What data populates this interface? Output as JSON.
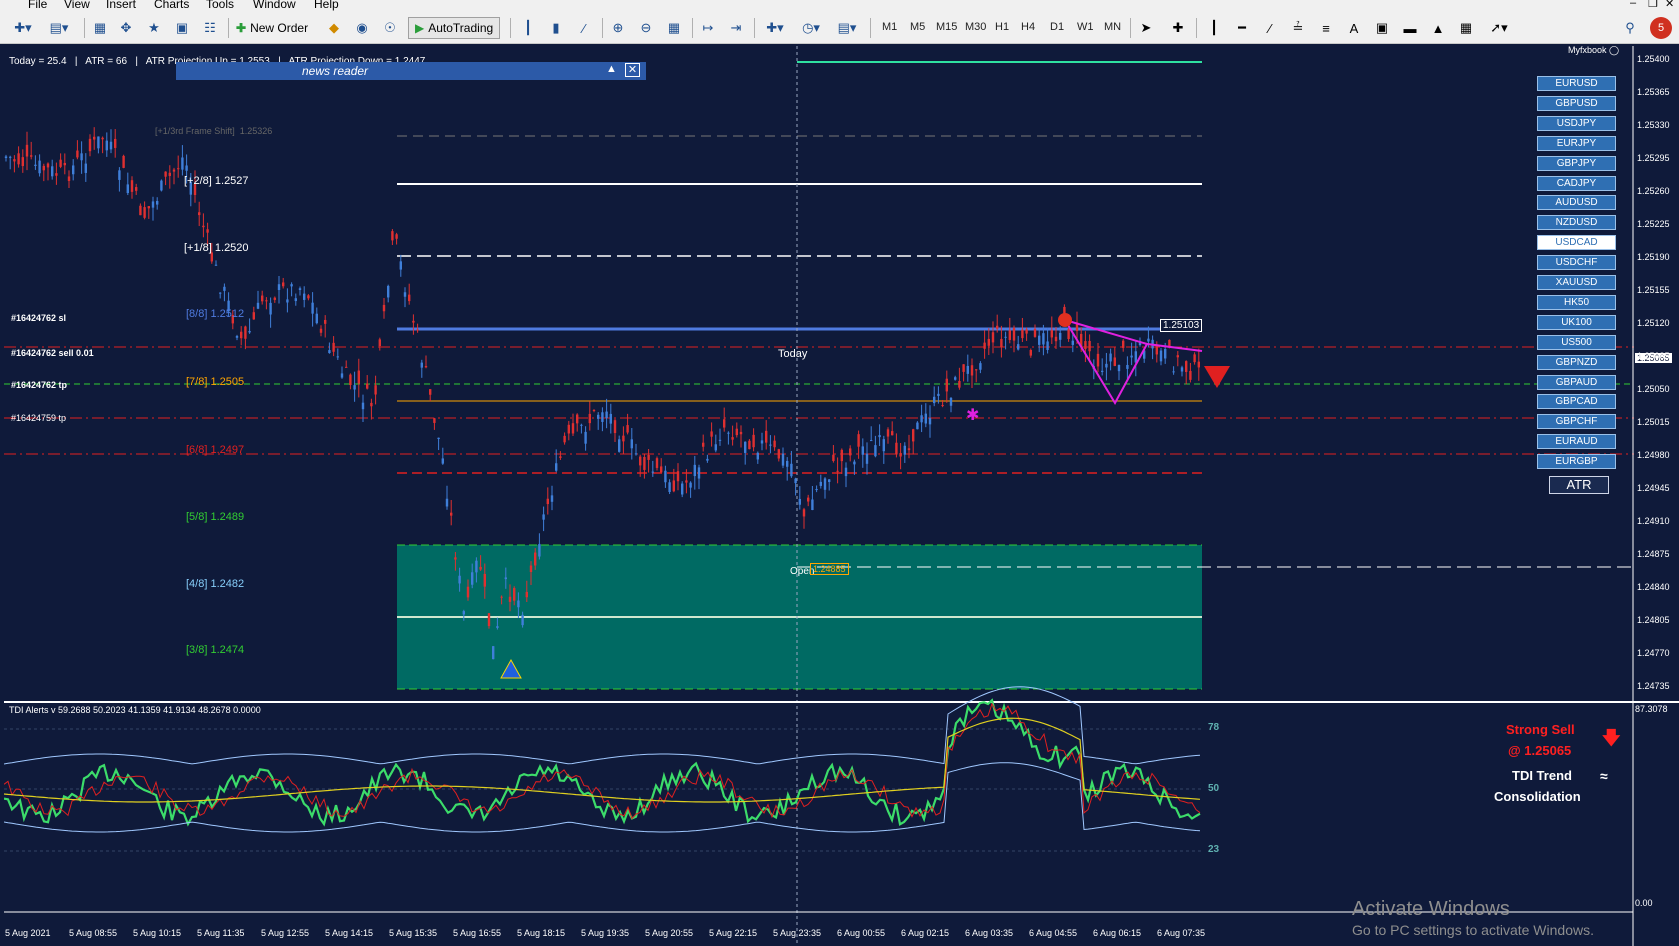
{
  "menu": {
    "items": [
      "File",
      "View",
      "Insert",
      "Charts",
      "Tools",
      "Window",
      "Help"
    ]
  },
  "toolbar": {
    "new_order_label": "New Order",
    "autotrading_label": "AutoTrading",
    "timeframes": [
      "M1",
      "M5",
      "M15",
      "M30",
      "H1",
      "H4",
      "D1",
      "W1",
      "MN"
    ]
  },
  "chart": {
    "info_line": "Today = 25.4   |   ATR = 66   |   ATR Projection Up = 1.2553   |   ATR Projection Down = 1.2447",
    "news_reader": "news reader",
    "myfxbook": "Myfxbook",
    "frame_shift": "[+1/3rd Frame Shift]  1.25326",
    "today_label": "Today",
    "open_label": "Open",
    "open_price": "1.24885",
    "current_price_label": "1.25103",
    "bid_price_label": "1.25065",
    "order_labels": [
      "#16424762 sl",
      "#16424762 sell 0.01",
      "#16424762 tp",
      "#16424759 tp"
    ],
    "murrey_levels": [
      {
        "label": "[+2/8]",
        "price": "1.2527",
        "color": "#ffffff"
      },
      {
        "label": "[+1/8]",
        "price": "1.2520",
        "color": "#ffffff"
      },
      {
        "label": "[8/8]",
        "price": "1.2512",
        "color": "#4f7be0"
      },
      {
        "label": "[7/8]",
        "price": "1.2505",
        "color": "#ffa500"
      },
      {
        "label": "[6/8]",
        "price": "1.2497",
        "color": "#e02020"
      },
      {
        "label": "[5/8]",
        "price": "1.2489",
        "color": "#32cd32"
      },
      {
        "label": "[4/8]",
        "price": "1.2482",
        "color": "#87cefa"
      },
      {
        "label": "[3/8]",
        "price": "1.2474",
        "color": "#32cd32"
      }
    ],
    "price_axis": [
      "1.25400",
      "1.25365",
      "1.25330",
      "1.25295",
      "1.25260",
      "1.25225",
      "1.25190",
      "1.25155",
      "1.25120",
      "1.25085",
      "1.25050",
      "1.25015",
      "1.24980",
      "1.24945",
      "1.24910",
      "1.24875",
      "1.24840",
      "1.24805",
      "1.24770",
      "1.24735"
    ],
    "time_axis": [
      "5 Aug 2021",
      "5 Aug 08:55",
      "5 Aug 10:15",
      "5 Aug 11:35",
      "5 Aug 12:55",
      "5 Aug 14:15",
      "5 Aug 15:35",
      "5 Aug 16:55",
      "5 Aug 18:15",
      "5 Aug 19:35",
      "5 Aug 20:55",
      "5 Aug 22:15",
      "5 Aug 23:35",
      "6 Aug 00:55",
      "6 Aug 02:15",
      "6 Aug 03:35",
      "6 Aug 04:55",
      "6 Aug 06:15",
      "6 Aug 07:35"
    ],
    "colors": {
      "background": "#0f1a3a",
      "bull": "#3f7fd9",
      "bear": "#e03030",
      "teal_zone": "#006a63"
    }
  },
  "symbols": [
    "EURUSD",
    "GBPUSD",
    "USDJPY",
    "EURJPY",
    "GBPJPY",
    "CADJPY",
    "AUDUSD",
    "NZDUSD",
    "USDCAD",
    "USDCHF",
    "XAUUSD",
    "HK50",
    "UK100",
    "US500",
    "GBPNZD",
    "GBPAUD",
    "GBPCAD",
    "GBPCHF",
    "EURAUD",
    "EURGBP"
  ],
  "active_symbol": "USDCAD",
  "atr_button": "ATR",
  "tdi": {
    "title": "TDI Alerts v 59.2688 50.2023 41.1359 41.9134 48.2678 0.0000",
    "axis_top": "87.3078",
    "axis_bottom": "0.00",
    "levels": [
      "78",
      "50",
      "23"
    ],
    "alert_line1": "Strong Sell",
    "alert_line2": "@ 1.25065",
    "trend_line1": "TDI Trend",
    "trend_line2": "Consolidation"
  },
  "watermark": {
    "line1": "Activate Windows",
    "line2": "Go to PC settings to activate Windows."
  }
}
